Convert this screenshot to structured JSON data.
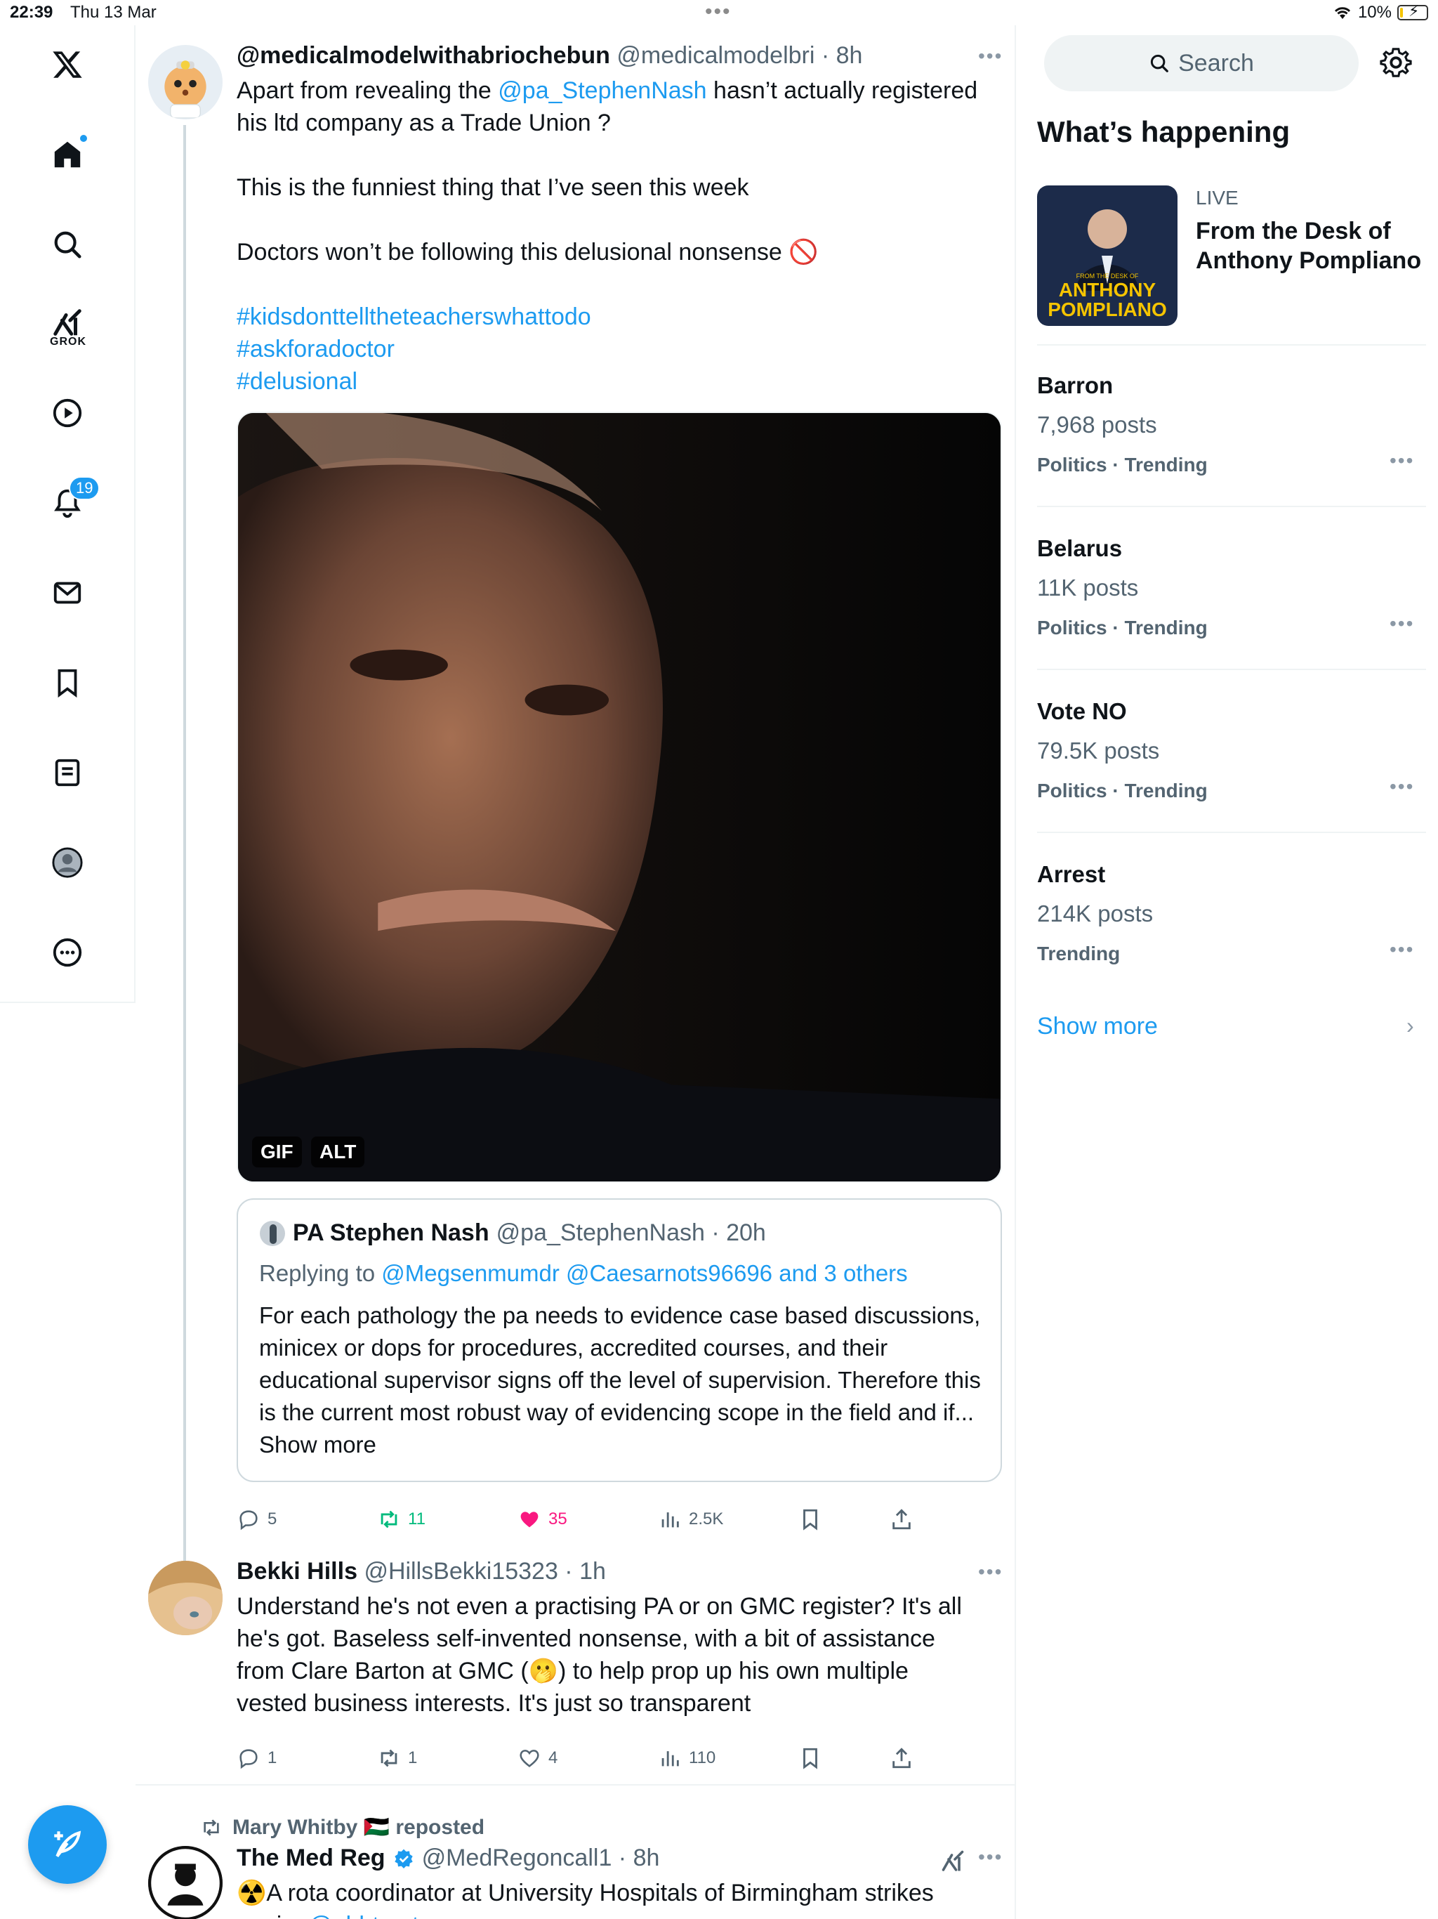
{
  "status_bar": {
    "time": "22:39",
    "date": "Thu 13 Mar",
    "battery": "10%",
    "battery_level": 0.1
  },
  "nav": {
    "notifications_count": "19",
    "grok_label": "GROK"
  },
  "tweets": [
    {
      "display_name": "@medicalmodelwithabriochebun",
      "handle_time": "@medicalmodelbri · 8h",
      "text_1a": "Apart from revealing the ",
      "mention": "@pa_StephenNash",
      "text_1b": " hasn’t actually registered",
      "text_2": "his ltd company as a Trade Union ?",
      "text_3": "This is the funniest thing that I’ve seen this week",
      "text_4": "Doctors won’t be following this delusional nonsense 🚫",
      "hashtag_1": "#kidsdonttelltheteacherswhattodo",
      "hashtag_2": "#askforadoctor",
      "hashtag_3": "#delusional",
      "media_badges": [
        "GIF",
        "ALT"
      ],
      "quote": {
        "name": "PA Stephen Nash",
        "handle_time": "@pa_StephenNash · 20h",
        "replying_prefix": "Replying to ",
        "replying_links": "@Megsenmumdr @Caesarnots96696 and 3 others",
        "text": "For each pathology the pa needs to evidence case based discussions, minicex or dops for procedures, accredited courses, and their educational supervisor signs off the level of supervision. Therefore this is the current most robust way of evidencing scope in the field and if... Show more"
      },
      "stats": {
        "replies": "5",
        "reposts": "11",
        "likes": "35",
        "views": "2.5K"
      }
    },
    {
      "display_name": "Bekki Hills",
      "handle_time": "@HillsBekki15323 · 1h",
      "text": "Understand he's not even a practising PA or on GMC register? It's all he's got. Baseless self-invented nonsense, with a bit of assistance from Clare Barton at GMC (🫢) to help prop up his own multiple vested business interests. It's just so transparent",
      "stats": {
        "replies": "1",
        "reposts": "1",
        "likes": "4",
        "views": "110"
      }
    },
    {
      "repost_by": "Mary Whitby 🇵🇸 reposted",
      "display_name": "The Med Reg",
      "handle_time": "@MedRegoncall1 · 8h",
      "text_a": "☢️A rota coordinator at University Hospitals of Birmingham strikes",
      "text_b": "again. ",
      "text_b_link": "@uhbtrust"
    }
  ],
  "sidebar": {
    "search_placeholder": "Search",
    "section_title": "What’s happening",
    "live": {
      "label": "LIVE",
      "title": "From the Desk of Anthony Pompliano",
      "thumb_small": "FROM THE DESK OF",
      "thumb_line1": "ANTHONY",
      "thumb_line2": "POMPLIANO"
    },
    "trends": [
      {
        "name": "Barron",
        "count": "7,968 posts",
        "category": "Politics · Trending"
      },
      {
        "name": "Belarus",
        "count": "11K posts",
        "category": "Politics · Trending"
      },
      {
        "name": "Vote NO",
        "count": "79.5K posts",
        "category": "Politics · Trending"
      },
      {
        "name": "Arrest",
        "count": "214K posts",
        "category": "Trending"
      }
    ],
    "show_more": "Show more"
  },
  "colors": {
    "accent": "#1d9bf0",
    "like": "#f91880",
    "repost": "#00ba7c",
    "text": "#0f1419",
    "muted": "#536471"
  }
}
